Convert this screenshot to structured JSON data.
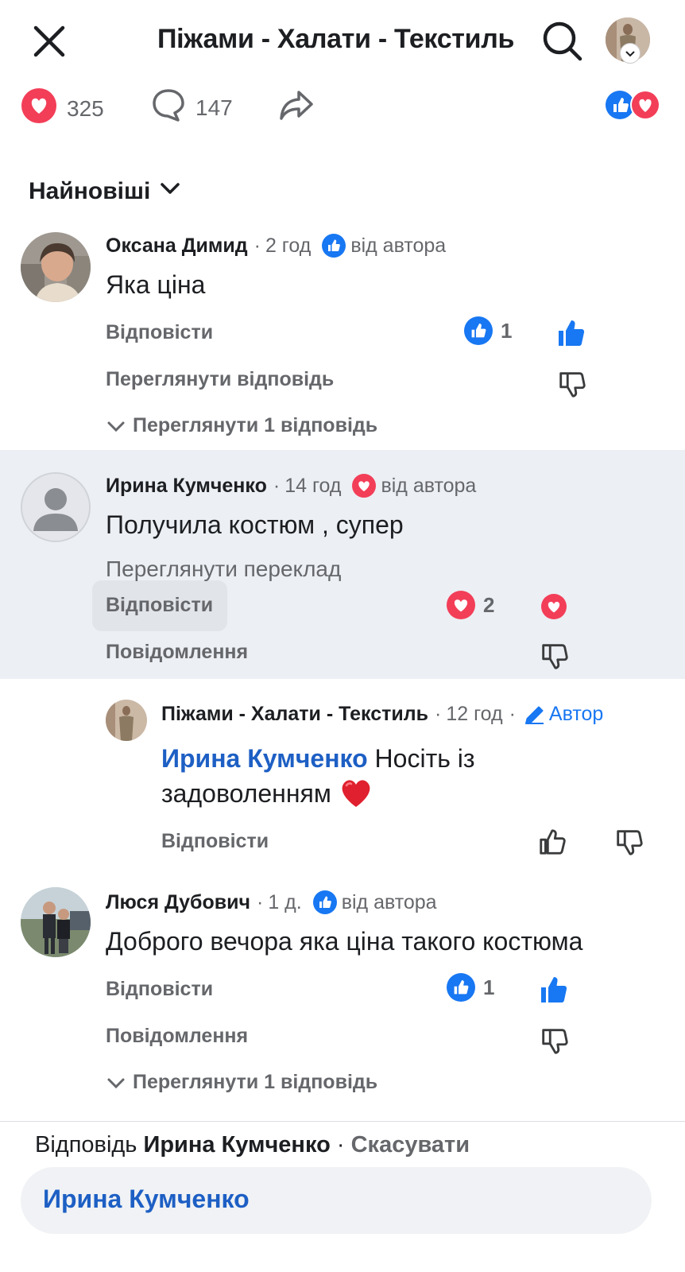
{
  "header": {
    "title": "Піжами - Халати - Текстиль",
    "close_icon": "close-icon",
    "search_icon": "search-icon"
  },
  "stats": {
    "reactions_count": "325",
    "comments_count": "147"
  },
  "sort": {
    "label": "Найновіші"
  },
  "comments": [
    {
      "name": "Оксана Димид",
      "time": "2 год",
      "author_reaction": "like",
      "by_author": "від автора",
      "text": "Яка ціна",
      "reply_label": "Відповісти",
      "secondary_label": "Переглянути відповідь",
      "reaction_count": "1",
      "view_replies": "Переглянути 1 відповідь"
    },
    {
      "name": "Ирина Кумченко",
      "time": "14 год",
      "author_reaction": "love",
      "by_author": "від автора",
      "text": "Получила костюм , супер",
      "translate": "Переглянути переклад",
      "reply_label": "Відповісти",
      "secondary_label": "Повідомлення",
      "reaction_count": "2"
    },
    {
      "name": "Піжами - Халати - Текстиль",
      "time": "12 год",
      "author_badge": "Автор",
      "mention": "Ирина Кумченко",
      "text": "Носіть із",
      "text_line2": "задоволенням",
      "emoji": "❤️",
      "reply_label": "Відповісти"
    },
    {
      "name": "Люся Дубович",
      "time": "1 д.",
      "author_reaction": "like",
      "by_author": "від автора",
      "text": "Доброго вечора яка ціна такого костюма",
      "reply_label": "Відповісти",
      "secondary_label": "Повідомлення",
      "reaction_count": "1",
      "view_replies": "Переглянути 1 відповідь"
    }
  ],
  "composer": {
    "reply_prefix": "Відповідь",
    "reply_name": "Ирина Кумченко",
    "separator": "·",
    "cancel": "Скасувати",
    "value": "Ирина Кумченко"
  },
  "colors": {
    "accent": "#1877f2",
    "love": "#f33e58",
    "muted": "#65676b",
    "highlight": "#eceff3"
  }
}
